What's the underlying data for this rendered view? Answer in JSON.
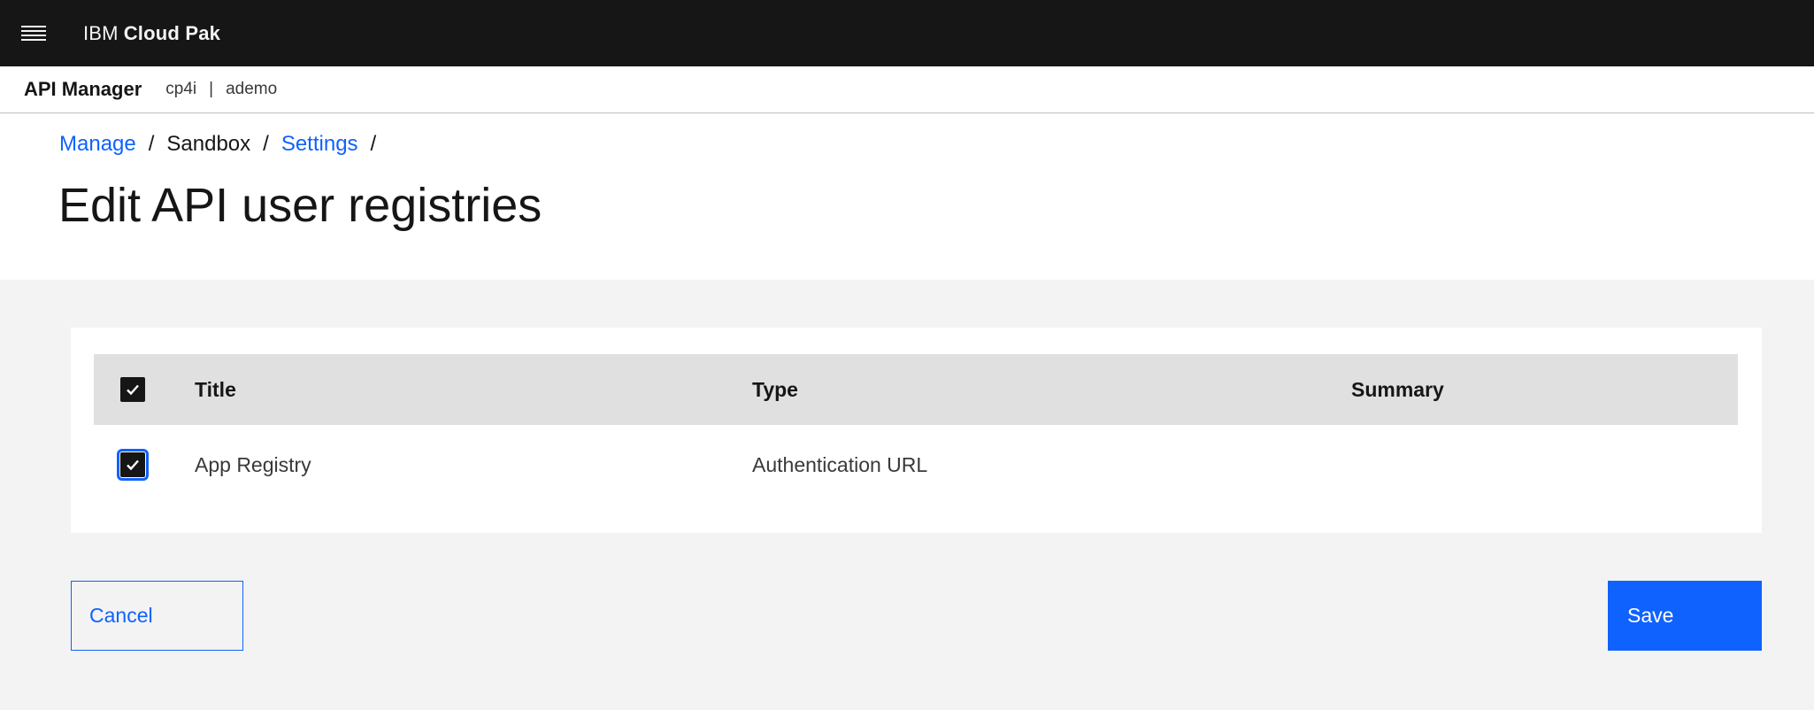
{
  "topbar": {
    "brand_prefix": "IBM",
    "brand_name": "Cloud Pak"
  },
  "subbar": {
    "app_name": "API Manager",
    "context_org": "cp4i",
    "context_separator": "|",
    "context_user": "ademo"
  },
  "breadcrumb": {
    "items": [
      {
        "label": "Manage",
        "link": true
      },
      {
        "label": "Sandbox",
        "link": false
      },
      {
        "label": "Settings",
        "link": true
      }
    ],
    "separator": "/"
  },
  "page": {
    "title": "Edit API user registries"
  },
  "table": {
    "headers": [
      "Title",
      "Type",
      "Summary"
    ],
    "select_all_checked": true,
    "rows": [
      {
        "checked": true,
        "title": "App Registry",
        "type": "Authentication URL",
        "summary": ""
      }
    ]
  },
  "actions": {
    "cancel_label": "Cancel",
    "save_label": "Save"
  },
  "colors": {
    "accent": "#0f62fe",
    "topbar_bg": "#161616",
    "page_bg": "#f3f3f3",
    "table_header_bg": "#e0e0e0"
  }
}
